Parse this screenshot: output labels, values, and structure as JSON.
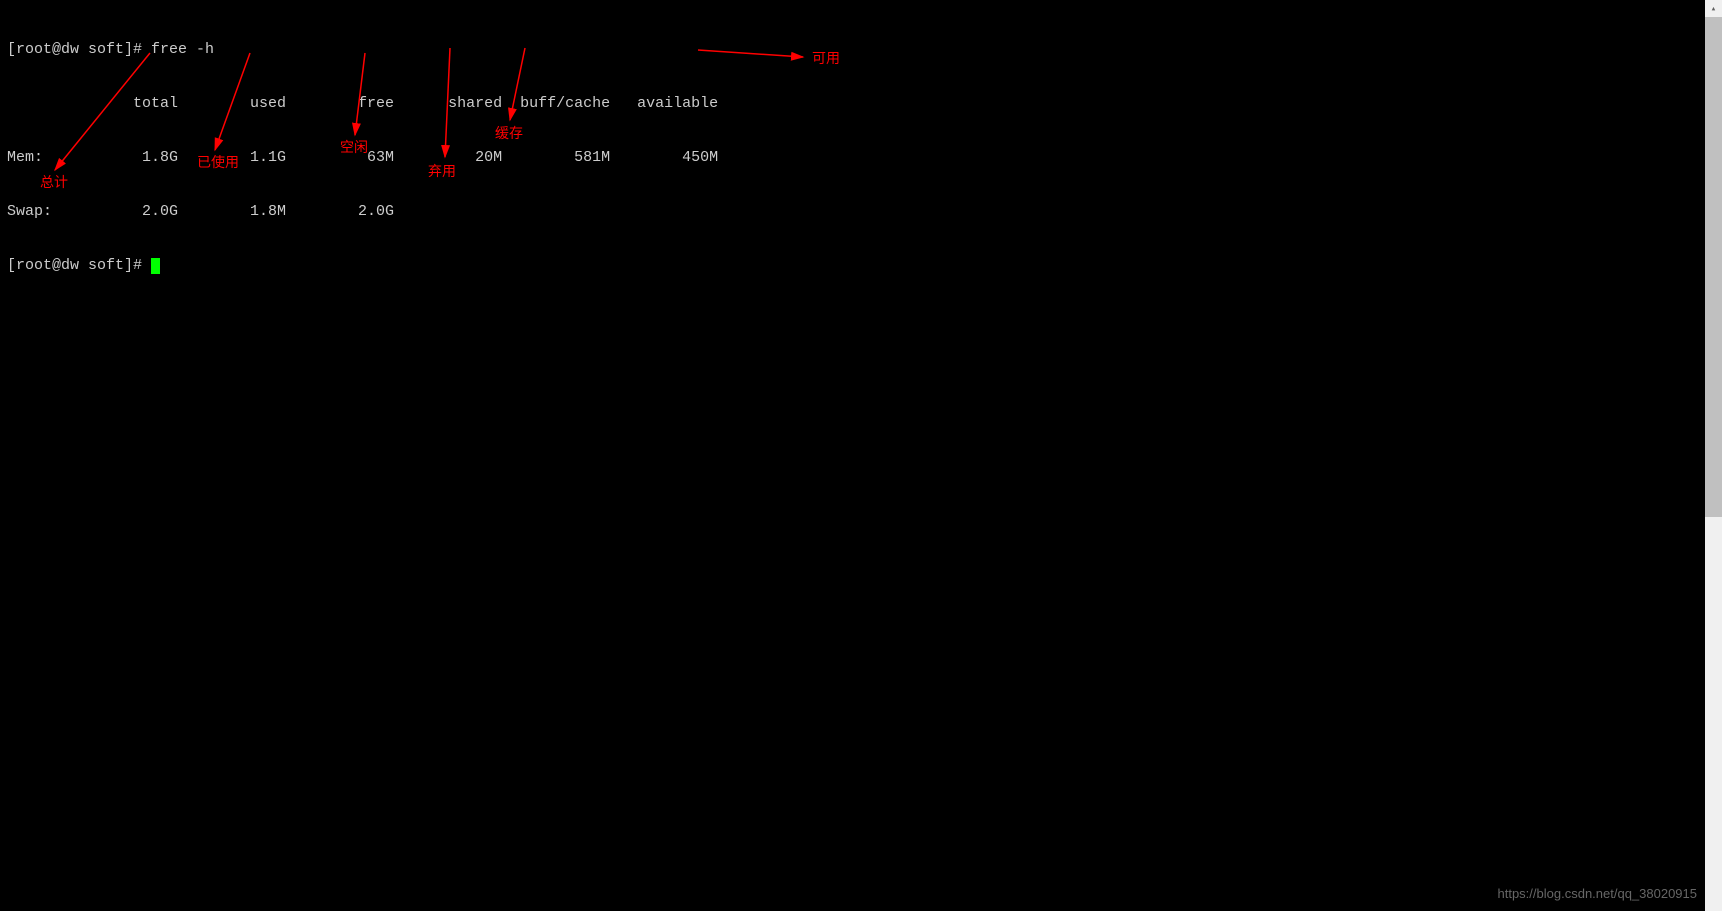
{
  "terminal": {
    "prompt1": "[root@dw soft]# ",
    "command": "free -h",
    "header": "              total        used        free      shared  buff/cache   available",
    "mem_row": "Mem:           1.8G        1.1G         63M         20M        581M        450M",
    "swap_row": "Swap:          2.0G        1.8M        2.0G",
    "prompt2": "[root@dw soft]# "
  },
  "annotations": {
    "total": "总计",
    "used": "已使用",
    "free": "空闲",
    "shared": "弃用",
    "buffcache": "缓存",
    "available": "可用"
  },
  "watermark": "https://blog.csdn.net/qq_38020915",
  "chart_data": {
    "type": "table",
    "title": "free -h output",
    "columns": [
      "",
      "total",
      "used",
      "free",
      "shared",
      "buff/cache",
      "available"
    ],
    "rows": [
      {
        "label": "Mem:",
        "total": "1.8G",
        "used": "1.1G",
        "free": "63M",
        "shared": "20M",
        "buff/cache": "581M",
        "available": "450M"
      },
      {
        "label": "Swap:",
        "total": "2.0G",
        "used": "1.8M",
        "free": "2.0G",
        "shared": "",
        "buff/cache": "",
        "available": ""
      }
    ],
    "column_annotations_zh": {
      "total": "总计",
      "used": "已使用",
      "free": "空闲",
      "shared": "弃用",
      "buff/cache": "缓存",
      "available": "可用"
    }
  }
}
